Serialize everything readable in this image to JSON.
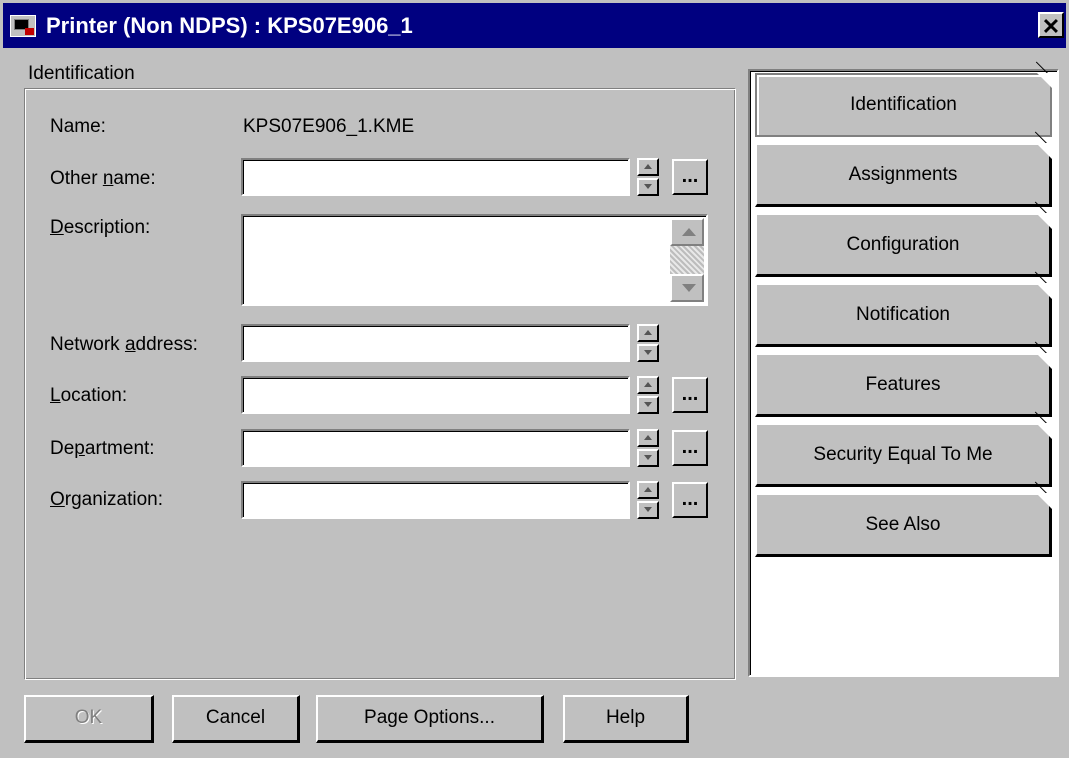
{
  "window": {
    "title": "Printer (Non NDPS) : KPS07E906_1"
  },
  "group": {
    "label": "Identification"
  },
  "fields": {
    "name_label": "Name:",
    "name_value": "KPS07E906_1.KME",
    "other_name_label": "Other name:",
    "other_name_value": "",
    "description_label": "Description:",
    "description_value": "",
    "network_address_label": "Network address:",
    "network_address_value": "",
    "location_label": "Location:",
    "location_value": "",
    "department_label": "Department:",
    "department_value": "",
    "organization_label": "Organization:",
    "organization_value": "",
    "browse_label": "..."
  },
  "pages": [
    {
      "label": "Identification",
      "active": true
    },
    {
      "label": "Assignments"
    },
    {
      "label": "Configuration"
    },
    {
      "label": "Notification"
    },
    {
      "label": "Features"
    },
    {
      "label": "Security Equal To Me"
    },
    {
      "label": "See Also"
    }
  ],
  "buttons": {
    "ok": "OK",
    "cancel": "Cancel",
    "page_options": "Page Options...",
    "help": "Help"
  },
  "icons": {
    "title": "printer-object-icon",
    "close": "close-icon"
  }
}
